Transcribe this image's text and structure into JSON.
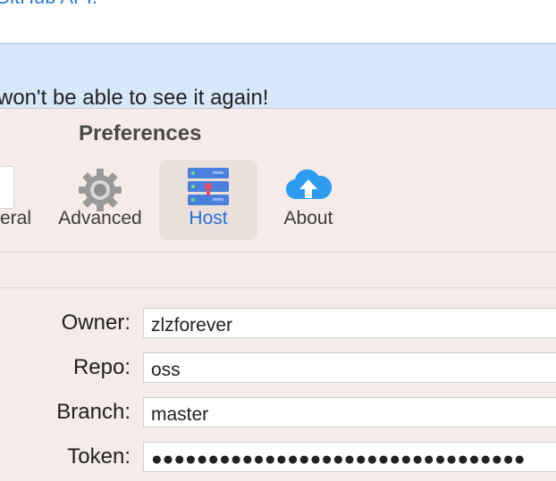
{
  "background": {
    "link_text": "GitHub API.",
    "warning_text": "won't be able to see it again!"
  },
  "window": {
    "title": "Preferences"
  },
  "toolbar": {
    "items": [
      {
        "label": "eral",
        "icon": "general-icon"
      },
      {
        "label": "Advanced",
        "icon": "gear-icon"
      },
      {
        "label": "Host",
        "icon": "server-icon",
        "selected": true
      },
      {
        "label": "About",
        "icon": "cloud-upload-icon"
      }
    ]
  },
  "form": {
    "owner": {
      "label": "Owner:",
      "value": "zlzforever"
    },
    "repo": {
      "label": "Repo:",
      "value": "oss"
    },
    "branch": {
      "label": "Branch:",
      "value": "master"
    },
    "token": {
      "label": "Token:",
      "value": "●●●●●●●●●●●●●●●●●●●●●●●●●●●●●●●●●"
    }
  },
  "colors": {
    "accent": "#2273d8",
    "window_bg": "#f5ebe8",
    "info_bg": "#d9e7fb",
    "link": "#2f76d2"
  }
}
